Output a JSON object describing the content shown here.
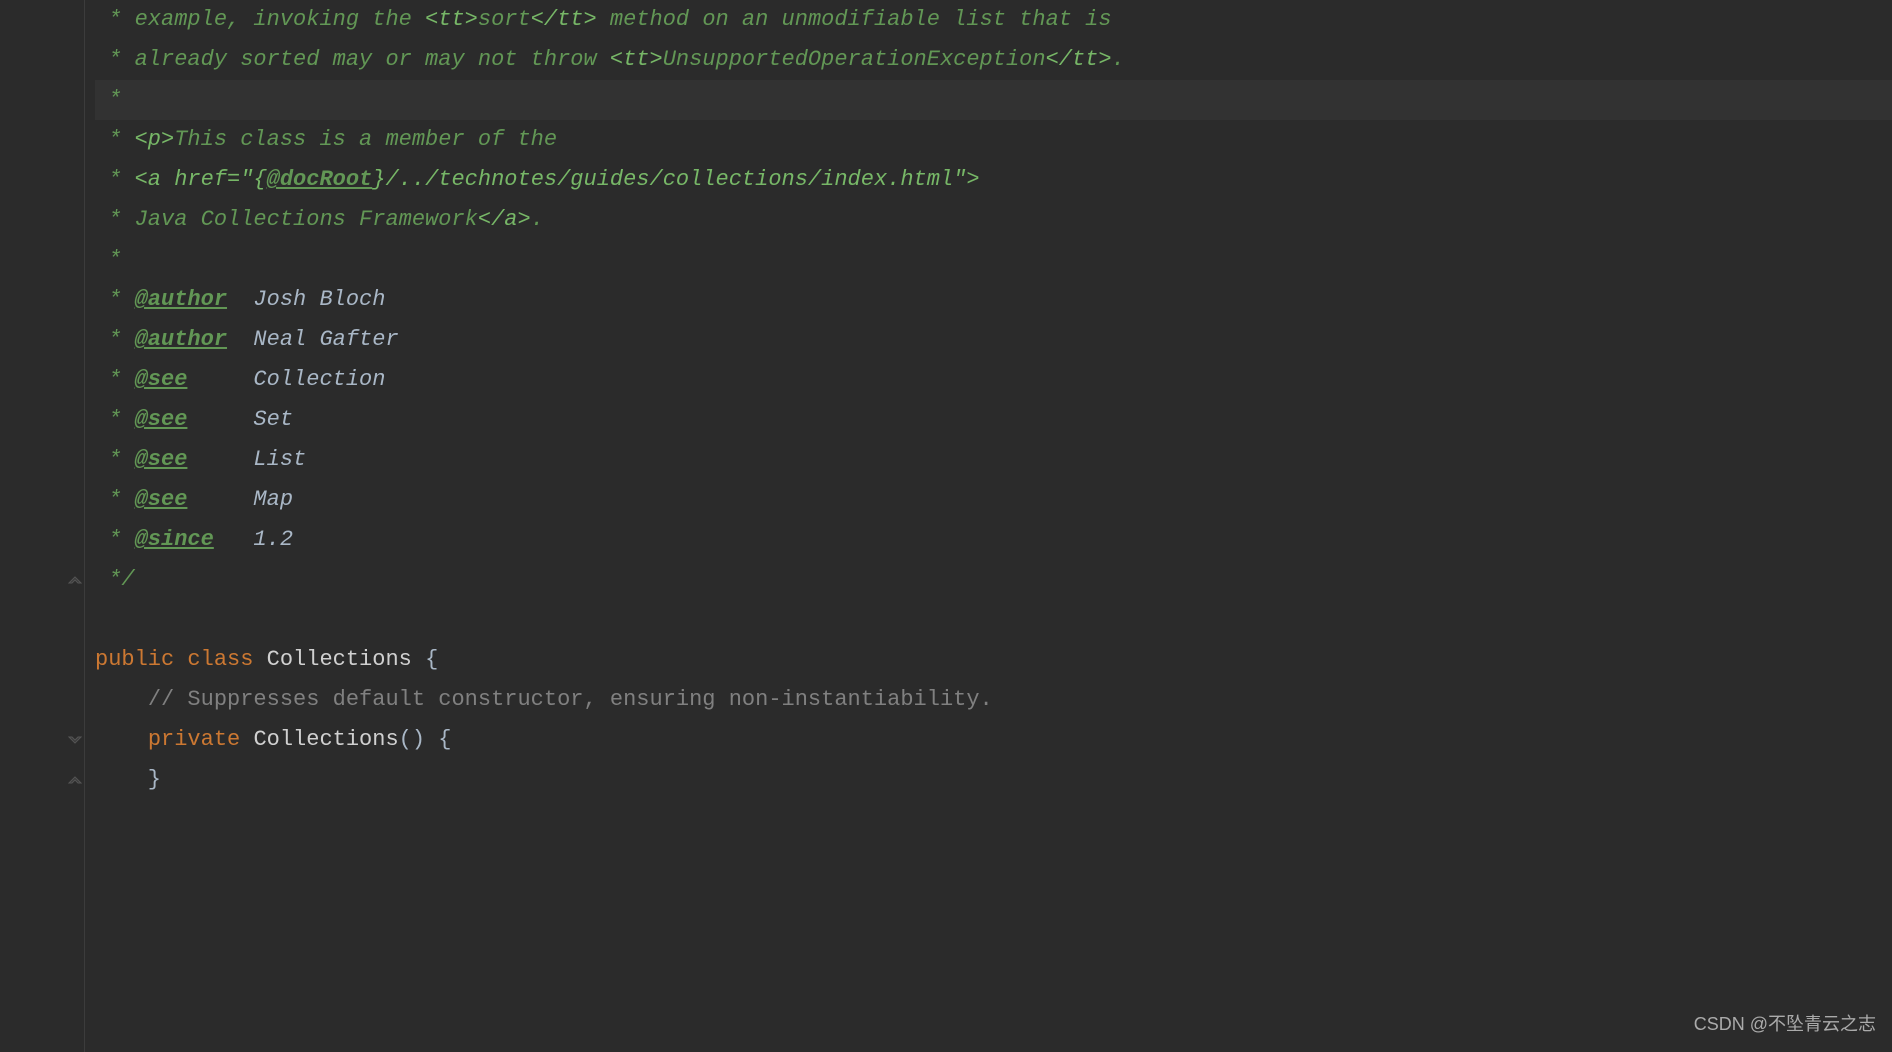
{
  "lines": [
    {
      "kind": "javadoc",
      "segments": [
        {
          "t": " * ",
          "c": "javadoc"
        },
        {
          "t": "example, invoking the ",
          "c": "javadoc"
        },
        {
          "t": "<tt>",
          "c": "javadoc-html"
        },
        {
          "t": "sort",
          "c": "javadoc"
        },
        {
          "t": "</tt>",
          "c": "javadoc-html"
        },
        {
          "t": " method on an unmodifiable list that is",
          "c": "javadoc"
        }
      ]
    },
    {
      "kind": "javadoc",
      "segments": [
        {
          "t": " * ",
          "c": "javadoc"
        },
        {
          "t": "already sorted may or may not throw ",
          "c": "javadoc"
        },
        {
          "t": "<tt>",
          "c": "javadoc-html"
        },
        {
          "t": "UnsupportedOperationException",
          "c": "javadoc"
        },
        {
          "t": "</tt>",
          "c": "javadoc-html"
        },
        {
          "t": ".",
          "c": "javadoc"
        }
      ]
    },
    {
      "kind": "javadoc",
      "highlighted": true,
      "segments": [
        {
          "t": " *",
          "c": "javadoc"
        }
      ]
    },
    {
      "kind": "javadoc",
      "segments": [
        {
          "t": " * ",
          "c": "javadoc"
        },
        {
          "t": "<p>",
          "c": "javadoc-html"
        },
        {
          "t": "This class is a member of the",
          "c": "javadoc"
        }
      ]
    },
    {
      "kind": "javadoc",
      "segments": [
        {
          "t": " * ",
          "c": "javadoc"
        },
        {
          "t": "<a href=\"{",
          "c": "javadoc-html"
        },
        {
          "t": "@docRoot",
          "c": "javadoc-link"
        },
        {
          "t": "}/../technotes/guides/collections/index.html\">",
          "c": "javadoc-html"
        }
      ]
    },
    {
      "kind": "javadoc",
      "segments": [
        {
          "t": " * ",
          "c": "javadoc"
        },
        {
          "t": "Java Collections Framework",
          "c": "javadoc"
        },
        {
          "t": "</a>",
          "c": "javadoc-html"
        },
        {
          "t": ".",
          "c": "javadoc"
        }
      ]
    },
    {
      "kind": "javadoc",
      "segments": [
        {
          "t": " *",
          "c": "javadoc"
        }
      ]
    },
    {
      "kind": "javadoc",
      "segments": [
        {
          "t": " * ",
          "c": "javadoc"
        },
        {
          "t": "@author",
          "c": "javadoc-tag"
        },
        {
          "t": "  Josh Bloch",
          "c": "plain-doc"
        }
      ]
    },
    {
      "kind": "javadoc",
      "segments": [
        {
          "t": " * ",
          "c": "javadoc"
        },
        {
          "t": "@author",
          "c": "javadoc-tag"
        },
        {
          "t": "  Neal Gafter",
          "c": "plain-doc"
        }
      ]
    },
    {
      "kind": "javadoc",
      "segments": [
        {
          "t": " * ",
          "c": "javadoc"
        },
        {
          "t": "@see",
          "c": "javadoc-tag"
        },
        {
          "t": "     Collection",
          "c": "plain-doc"
        }
      ]
    },
    {
      "kind": "javadoc",
      "segments": [
        {
          "t": " * ",
          "c": "javadoc"
        },
        {
          "t": "@see",
          "c": "javadoc-tag"
        },
        {
          "t": "     Set",
          "c": "plain-doc"
        }
      ]
    },
    {
      "kind": "javadoc",
      "segments": [
        {
          "t": " * ",
          "c": "javadoc"
        },
        {
          "t": "@see",
          "c": "javadoc-tag"
        },
        {
          "t": "     List",
          "c": "plain-doc"
        }
      ]
    },
    {
      "kind": "javadoc",
      "segments": [
        {
          "t": " * ",
          "c": "javadoc"
        },
        {
          "t": "@see",
          "c": "javadoc-tag"
        },
        {
          "t": "     Map",
          "c": "plain-doc"
        }
      ]
    },
    {
      "kind": "javadoc",
      "segments": [
        {
          "t": " * ",
          "c": "javadoc"
        },
        {
          "t": "@since",
          "c": "javadoc-tag"
        },
        {
          "t": "   1.2",
          "c": "plain-doc"
        }
      ]
    },
    {
      "kind": "javadoc",
      "fold": "end",
      "segments": [
        {
          "t": " */",
          "c": "javadoc"
        }
      ]
    },
    {
      "kind": "blank",
      "segments": [
        {
          "t": "",
          "c": "plain-doc"
        }
      ]
    },
    {
      "kind": "code",
      "segments": [
        {
          "t": "public class ",
          "c": "keyword"
        },
        {
          "t": "Collections ",
          "c": "classname"
        },
        {
          "t": "{",
          "c": "brace"
        }
      ]
    },
    {
      "kind": "code",
      "segments": [
        {
          "t": "    ",
          "c": "brace"
        },
        {
          "t": "// Suppresses default constructor, ensuring non-instantiability.",
          "c": "comment"
        }
      ]
    },
    {
      "kind": "code",
      "fold": "collapse",
      "segments": [
        {
          "t": "    ",
          "c": "brace"
        },
        {
          "t": "private ",
          "c": "keyword"
        },
        {
          "t": "Collections",
          "c": "classname"
        },
        {
          "t": "() {",
          "c": "brace"
        }
      ]
    },
    {
      "kind": "code",
      "fold": "end",
      "segments": [
        {
          "t": "    }",
          "c": "brace"
        }
      ]
    }
  ],
  "watermark": "CSDN @不坠青云之志"
}
